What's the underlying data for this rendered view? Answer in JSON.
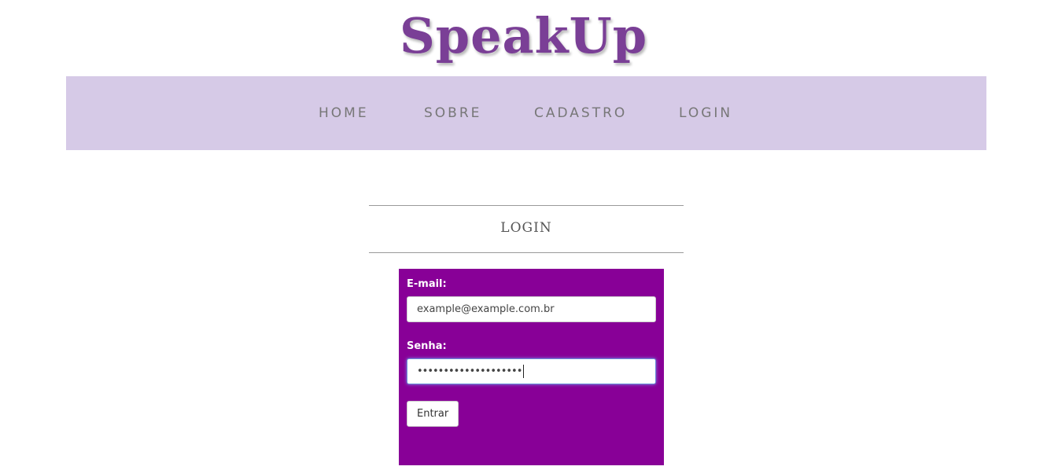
{
  "brand": {
    "title": "SpeakUp"
  },
  "nav": {
    "items": [
      {
        "label": "HOME"
      },
      {
        "label": "SOBRE"
      },
      {
        "label": "CADASTRO"
      },
      {
        "label": "LOGIN"
      }
    ]
  },
  "section": {
    "title": "LOGIN"
  },
  "form": {
    "email": {
      "label": "E-mail:",
      "value": "example@example.com.br"
    },
    "password": {
      "label": "Senha:",
      "masked_value": "••••••••••••••••••••"
    },
    "submit_label": "Entrar"
  },
  "colors": {
    "brand": "#7a3f96",
    "nav_background": "#d6cae7",
    "panel_background": "#880097"
  }
}
